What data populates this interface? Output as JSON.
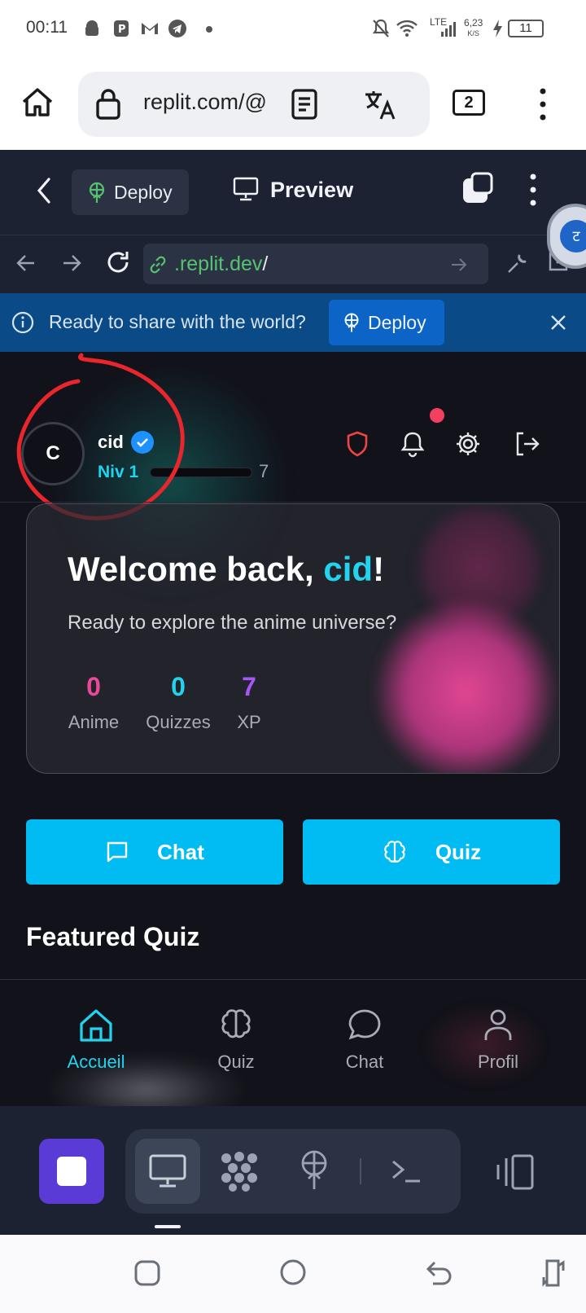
{
  "status_bar": {
    "time": "00:11",
    "net_speed": "6,23",
    "net_unit": "K/S",
    "net_type": "LTE",
    "battery": "11"
  },
  "browser": {
    "url": "replit.com/@",
    "tab_count": "2"
  },
  "replit_header": {
    "deploy_label": "Deploy",
    "preview_label": "Preview",
    "url_prefix": ".replit.dev",
    "url_suffix": "/"
  },
  "banner": {
    "text": "Ready to share with the world?",
    "deploy_label": "Deploy"
  },
  "app": {
    "user": {
      "initial": "C",
      "name": "cid",
      "level": "Niv 1",
      "xp_progress": 0.0,
      "xp": "7"
    },
    "welcome": {
      "prefix": "Welcome back, ",
      "name": "cid",
      "suffix": "!",
      "subtitle": "Ready to explore the anime universe?"
    },
    "stats": [
      {
        "value": "0",
        "label": "Anime",
        "color": "#ec4899"
      },
      {
        "value": "0",
        "label": "Quizzes",
        "color": "#22d3ee"
      },
      {
        "value": "7",
        "label": "XP",
        "color": "#a855f7"
      }
    ],
    "actions": {
      "chat": "Chat",
      "quiz": "Quiz"
    },
    "featured_title": "Featured Quiz",
    "nav": [
      {
        "label": "Accueil",
        "icon": "home-icon",
        "active": true
      },
      {
        "label": "Quiz",
        "icon": "brain-icon",
        "active": false
      },
      {
        "label": "Chat",
        "icon": "chat-bubble-icon",
        "active": false
      },
      {
        "label": "Profil",
        "icon": "user-icon",
        "active": false
      }
    ]
  },
  "colors": {
    "accent": "#22d3ee",
    "button": "#00bcf2",
    "pink": "#ec4899",
    "purple": "#a855f7",
    "replit_bg": "#1c2232",
    "banner": "#0a4a87"
  }
}
